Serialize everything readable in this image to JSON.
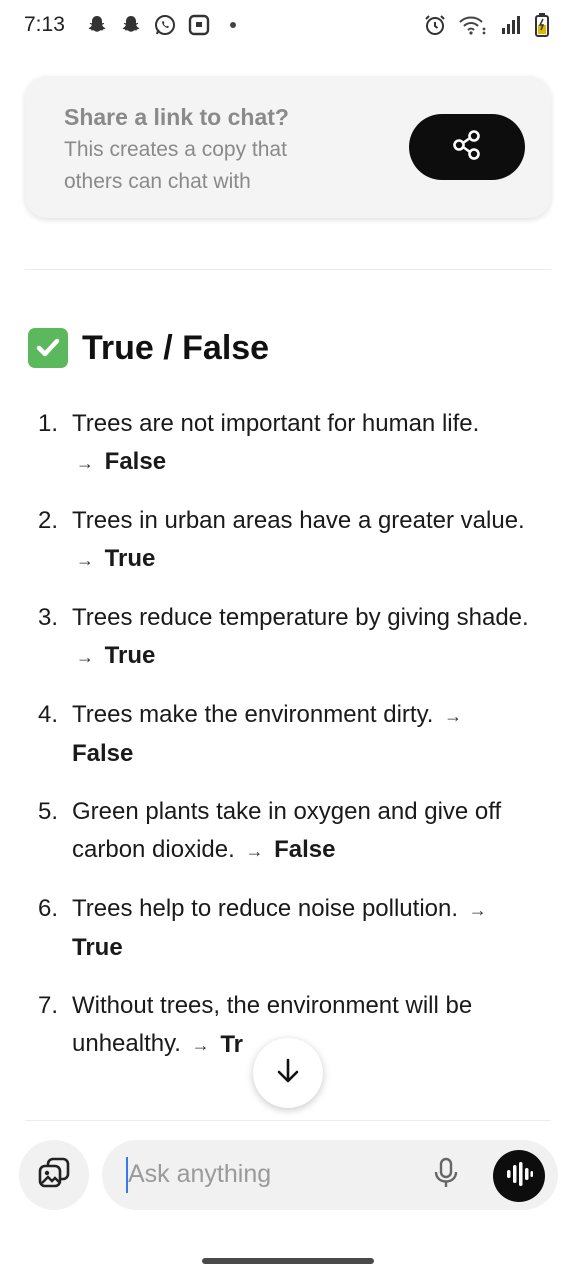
{
  "status_bar": {
    "time": "7:13",
    "left_icons": [
      "snapchat-icon",
      "snapchat-icon",
      "whatsapp-icon",
      "app-notification-icon",
      "dot-icon"
    ],
    "right_icons": [
      "alarm-icon",
      "wifi-icon",
      "signal-icon",
      "battery-icon"
    ]
  },
  "share_card": {
    "title": "Share a link to chat?",
    "description": "This creates a copy that others can chat with",
    "button_icon": "share-icon"
  },
  "section": {
    "heading_icon": "check-mark-emoji-icon",
    "heading": "True / False",
    "arrow": "→",
    "items": [
      {
        "number": "1.",
        "question": "Trees are not important for human life.",
        "answer": "False"
      },
      {
        "number": "2.",
        "question": "Trees in urban areas have a greater value.",
        "answer": "True"
      },
      {
        "number": "3.",
        "question": "Trees reduce temperature by giving shade.",
        "answer": "True"
      },
      {
        "number": "4.",
        "question": "Trees make the environment dirty.",
        "answer": "False"
      },
      {
        "number": "5.",
        "question": "Green plants take in oxygen and give off carbon dioxide.",
        "answer": "False"
      },
      {
        "number": "6.",
        "question": "Trees help to reduce noise pollution.",
        "answer": "True"
      },
      {
        "number": "7.",
        "question": "Without trees, the environment will be unhealthy.",
        "answer": "Tr"
      }
    ]
  },
  "scroll_button_icon": "arrow-down-icon",
  "composer": {
    "attach_icon": "image-attach-icon",
    "placeholder": "Ask anything",
    "mic_icon": "microphone-icon",
    "voice_icon": "voice-mode-icon"
  },
  "colors": {
    "accent_dark": "#0d0d0d",
    "check_green": "#5cb85c",
    "caret_blue": "#3478f6",
    "card_bg": "#f4f4f4",
    "muted_text": "#8a8a8a"
  }
}
